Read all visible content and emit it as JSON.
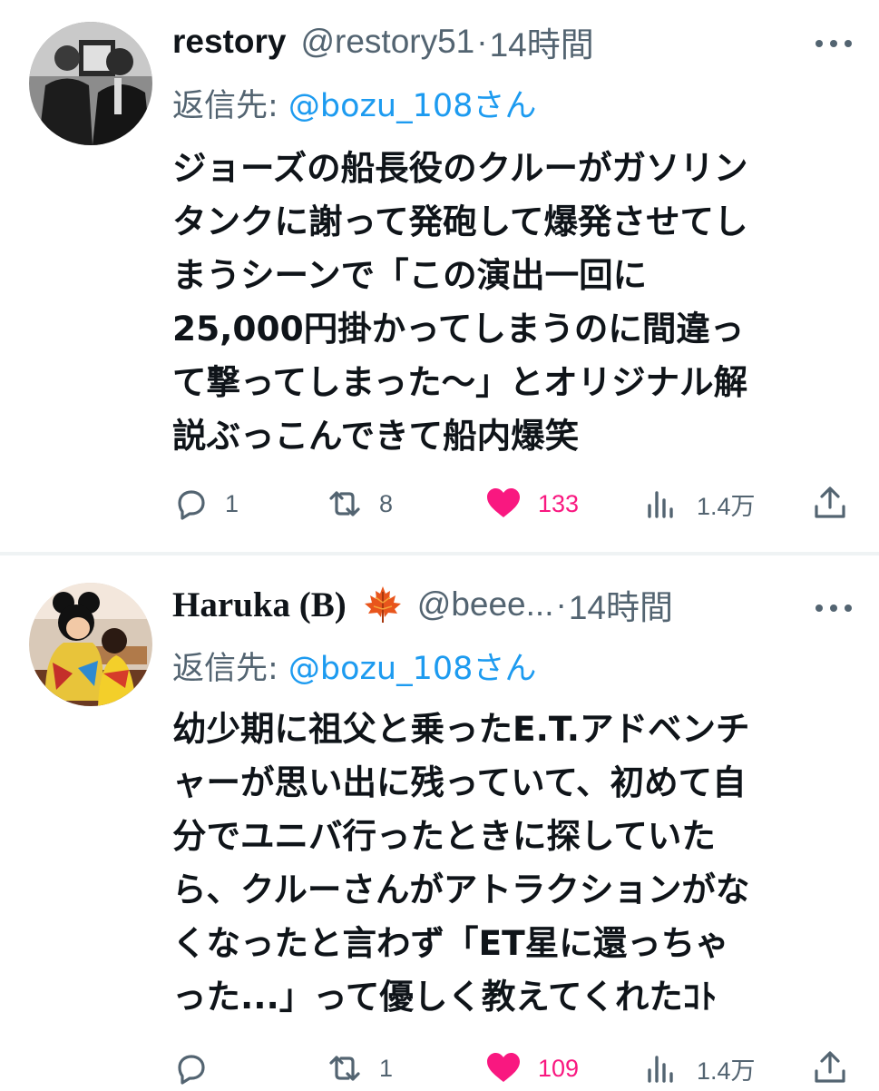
{
  "tweets": [
    {
      "name": "restory",
      "handle": "@restory51",
      "separator": "·",
      "time": "14時間",
      "reply_prefix": "返信先: ",
      "reply_to": "@bozu_108さん",
      "lines": [
        "ジョーズの船長役のクルーがガソリン",
        "タンクに謝って発砲して爆発させてし",
        "まうシーンで「この演出一回に",
        "25,000円掛かってしまうのに間違っ",
        "て撃ってしまった〜」とオリジナル解",
        "説ぶっこんできて船内爆笑"
      ],
      "replies": "1",
      "retweets": "8",
      "likes": "133",
      "views": "1.4万"
    },
    {
      "name": "Haruka (B)",
      "badge_icon": "maple-leaf-icon",
      "handle": "@beee...",
      "separator": "·",
      "time": "14時間",
      "reply_prefix": "返信先: ",
      "reply_to": "@bozu_108さん",
      "lines": [
        "幼少期に祖父と乗ったE.T.アドベンチ",
        "ャーが思い出に残っていて、初めて自",
        "分でユニバ行ったときに探していた",
        "ら、クルーさんがアトラクションがな",
        "くなったと言わず「ET星に還っちゃ",
        "った...」って優しく教えてくれたｺﾄ"
      ],
      "replies": "",
      "retweets": "1",
      "likes": "109",
      "views": "1.4万"
    }
  ],
  "colors": {
    "text": "#0f1419",
    "secondary": "#536471",
    "mention": "#1d9bf0",
    "like": "#f91880",
    "divider": "#eff3f4"
  }
}
